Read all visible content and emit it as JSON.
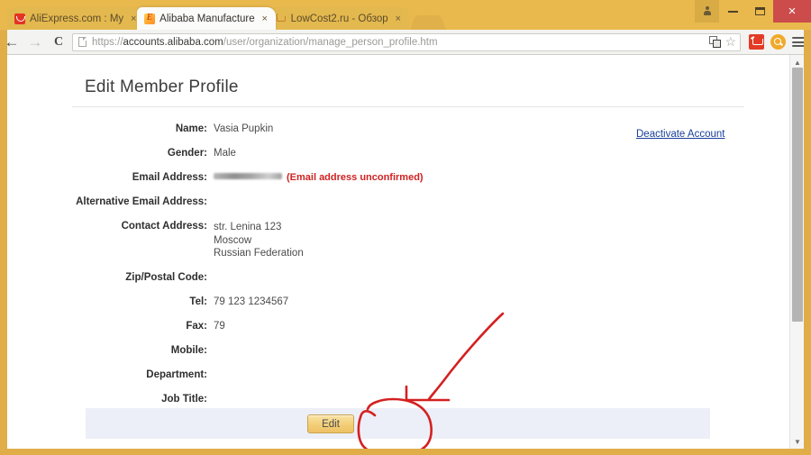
{
  "browser": {
    "tabs": [
      {
        "title": "AliExpress.com : My ",
        "favicon": "aliexpress-favicon",
        "active": false,
        "close_label": "×"
      },
      {
        "title": "Alibaba Manufacture",
        "favicon": "alibaba-favicon",
        "active": true,
        "close_label": "×"
      },
      {
        "title": "LowCost2.ru - Обзор",
        "favicon": "lowcost-favicon",
        "active": false,
        "close_label": "×"
      }
    ],
    "window_controls": {
      "user_icon": "person-icon",
      "minimize_label": "–",
      "maximize_label": "□",
      "close_label": "×"
    },
    "toolbar": {
      "back_label": "←",
      "forward_label": "→",
      "reload_label": "C",
      "url_scheme": "https://",
      "url_host": "accounts.alibaba.com",
      "url_path": "/user/organization/manage_person_profile.htm",
      "url_full": "https://accounts.alibaba.com/user/organization/manage_person_profile.htm",
      "translate_icon": "translate-icon",
      "bookmark_star": "☆",
      "extension_cart": "cart-extension-icon",
      "extension_search": "search-extension-icon",
      "menu_label": "menu-icon"
    },
    "scrollbar": {
      "up_arrow": "▲",
      "down_arrow": "▼"
    }
  },
  "page": {
    "title": "Edit Member Profile",
    "deactivate_link": "Deactivate Account",
    "fields": [
      {
        "label": "Name:",
        "value": "Vasia Pupkin"
      },
      {
        "label": "Gender:",
        "value": "Male"
      },
      {
        "label": "Email Address:",
        "value": "",
        "redacted": true,
        "note": "(Email address unconfirmed)"
      },
      {
        "label": "Alternative Email Address:",
        "value": ""
      },
      {
        "label": "Contact Address:",
        "value": "",
        "lines": [
          "str. Lenina 123",
          "Moscow",
          "Russian Federation"
        ]
      },
      {
        "label": "Zip/Postal Code:",
        "value": ""
      },
      {
        "label": "Tel:",
        "value": "79 123 1234567"
      },
      {
        "label": "Fax:",
        "value": "79"
      },
      {
        "label": "Mobile:",
        "value": ""
      },
      {
        "label": "Department:",
        "value": ""
      },
      {
        "label": "Job Title:",
        "value": ""
      }
    ],
    "edit_button": "Edit"
  },
  "annotation": {
    "color": "#d42020",
    "shapes": [
      "arrow-pointing-to-edit-button",
      "circle-around-edit-button"
    ]
  }
}
